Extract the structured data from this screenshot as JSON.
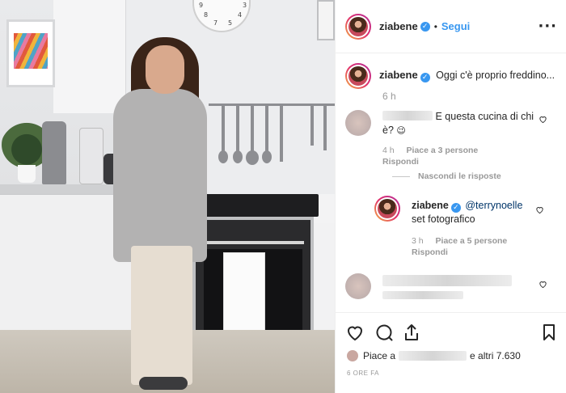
{
  "post": {
    "username": "ziabene",
    "separator": "•",
    "follow_label": "Segui",
    "more_label": "···"
  },
  "clock": {
    "numbers": [
      "9",
      "8",
      "7",
      "5",
      "4",
      "3"
    ]
  },
  "caption": {
    "username": "ziabene",
    "text": "Oggi c'è proprio freddino...",
    "time": "6 h"
  },
  "comments": [
    {
      "text_line1": "E questa cucina di chi",
      "text_line2": "è?",
      "emoji": "😉",
      "time": "4 h",
      "likes": "Piace a 3 persone",
      "reply_label": "Rispondi",
      "hide_replies_label": "Nascondi le risposte"
    },
    {
      "username": "ziabene",
      "mention": "@terrynoelle",
      "text": "set fotografico",
      "time": "3 h",
      "likes": "Piace a 5 persone",
      "reply_label": "Rispondi"
    }
  ],
  "actions": {
    "liked_by_prefix": "Piace a",
    "liked_by_suffix": "e altri 7.630",
    "posted_ago": "6 ORE FA"
  },
  "colors": {
    "accent": "#3897f0",
    "text": "#262626",
    "muted": "#999999"
  },
  "icons": [
    "verified-badge-icon",
    "more-options-icon",
    "heart-icon",
    "comment-icon",
    "share-icon",
    "bookmark-icon"
  ]
}
